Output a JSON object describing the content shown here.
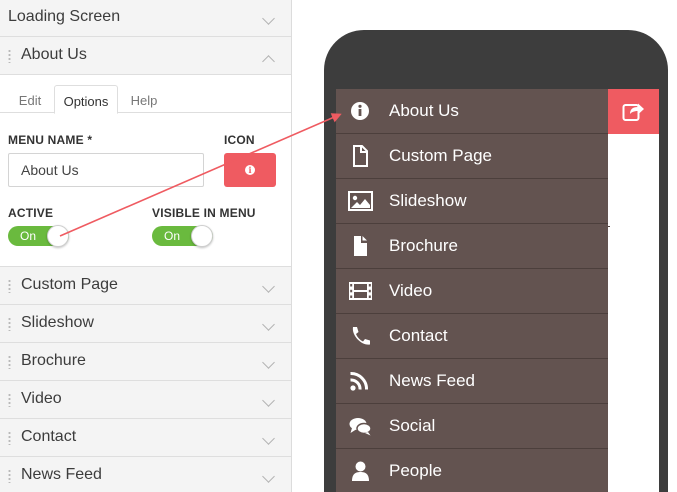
{
  "panel": {
    "sections": [
      {
        "label": "Loading Screen",
        "expanded": false
      },
      {
        "label": "About Us",
        "expanded": true
      },
      {
        "label": "Custom Page",
        "expanded": false
      },
      {
        "label": "Slideshow",
        "expanded": false
      },
      {
        "label": "Brochure",
        "expanded": false
      },
      {
        "label": "Video",
        "expanded": false
      },
      {
        "label": "Contact",
        "expanded": false
      },
      {
        "label": "News Feed",
        "expanded": false
      }
    ],
    "tabs": [
      {
        "label": "Edit",
        "active": false
      },
      {
        "label": "Options",
        "active": true
      },
      {
        "label": "Help",
        "active": false
      }
    ],
    "form": {
      "menu_name_label": "MENU NAME *",
      "menu_name_value": "About Us",
      "icon_label": "ICON",
      "icon_name": "info-icon",
      "active_label": "ACTIVE",
      "active_toggle": "On",
      "visible_label": "VISIBLE IN MENU",
      "visible_toggle": "On"
    }
  },
  "phone": {
    "menu_items": [
      {
        "label": "About Us",
        "icon": "info-icon"
      },
      {
        "label": "Custom Page",
        "icon": "page-icon"
      },
      {
        "label": "Slideshow",
        "icon": "image-icon"
      },
      {
        "label": "Brochure",
        "icon": "document-icon"
      },
      {
        "label": "Video",
        "icon": "film-icon"
      },
      {
        "label": "Contact",
        "icon": "phone-icon"
      },
      {
        "label": "News Feed",
        "icon": "rss-icon"
      },
      {
        "label": "Social",
        "icon": "chat-icon"
      },
      {
        "label": "People",
        "icon": "person-icon"
      }
    ],
    "share_icon": "share-icon"
  },
  "colors": {
    "accent": "#ef5b61",
    "toggle_on": "#6aba3e",
    "menu_bg": "#635350",
    "phone_frame": "#3d3d3d",
    "panel_bg": "#f4f4f4"
  }
}
